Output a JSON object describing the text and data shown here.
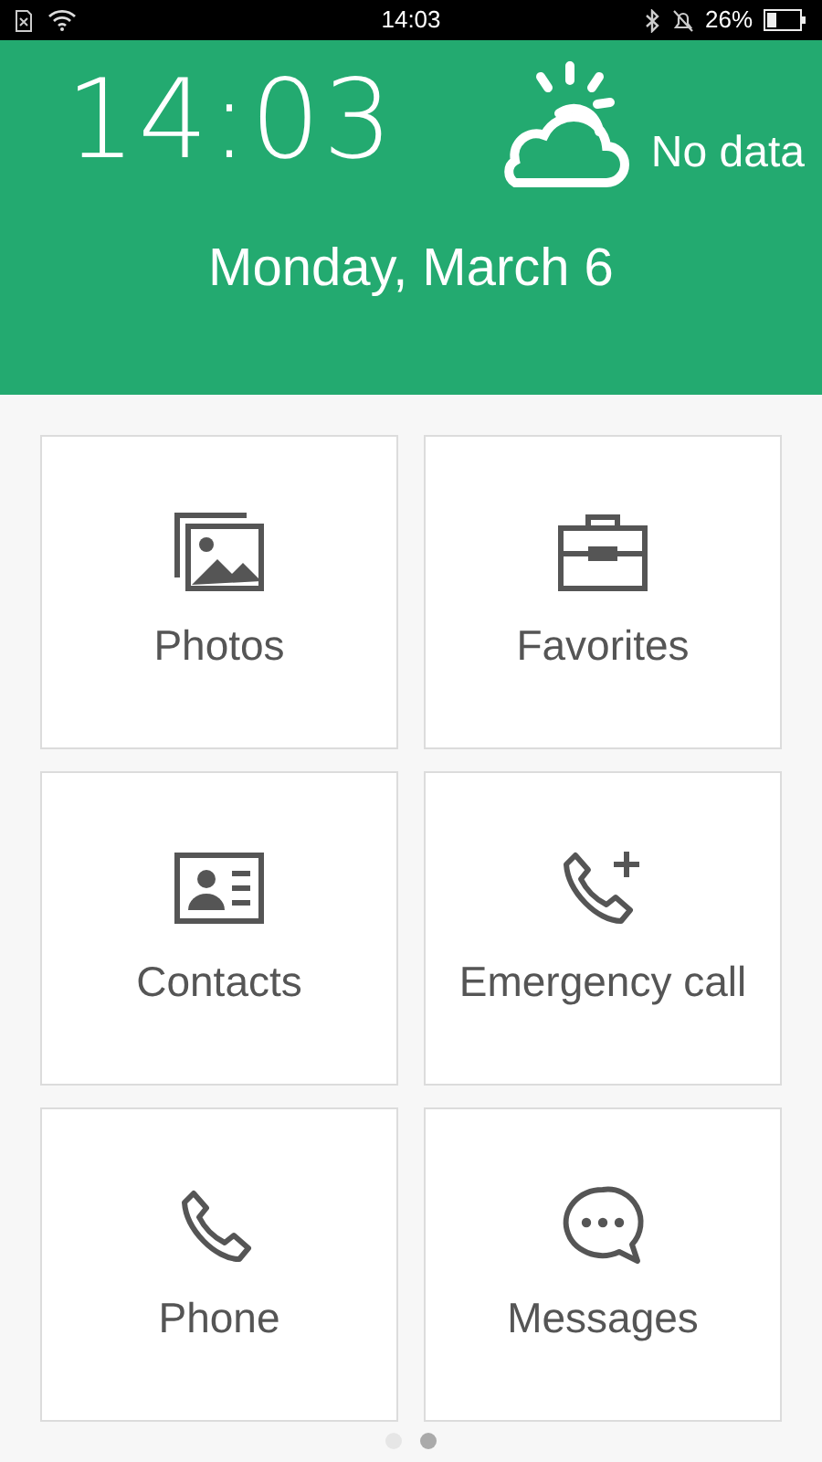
{
  "status_bar": {
    "time": "14:03",
    "battery": "26%"
  },
  "header": {
    "clock": "14:03",
    "weather": "No data",
    "date": "Monday, March 6"
  },
  "tiles": [
    {
      "kind": "photos",
      "label": "Photos"
    },
    {
      "kind": "briefcase",
      "label": "Favorites"
    },
    {
      "kind": "contact-card",
      "label": "Contacts"
    },
    {
      "kind": "phone-plus",
      "label": "Emergency call"
    },
    {
      "kind": "phone",
      "label": "Phone"
    },
    {
      "kind": "chat",
      "label": "Messages"
    }
  ],
  "pages": [
    {
      "selected": false
    },
    {
      "selected": true
    }
  ]
}
